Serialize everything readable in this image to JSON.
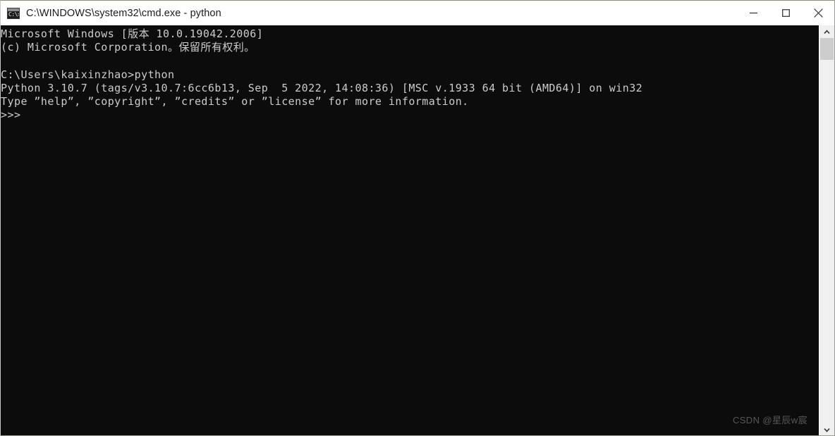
{
  "window": {
    "title": "C:\\WINDOWS\\system32\\cmd.exe - python",
    "icon": "cmd-icon",
    "icon_glyph": "C:\\>",
    "background_color": "#0c0c0c",
    "text_color": "#cccccc",
    "titlebar_color": "#ffffff",
    "controls": {
      "minimize": "minimize-icon",
      "maximize": "maximize-icon",
      "close": "close-icon"
    }
  },
  "console": {
    "lines": [
      "Microsoft Windows [版本 10.0.19042.2006]",
      "(c) Microsoft Corporation。保留所有权利。",
      "",
      "C:\\Users\\kaixinzhao>python",
      "Python 3.10.7 (tags/v3.10.7:6cc6b13, Sep  5 2022, 14:08:36) [MSC v.1933 64 bit (AMD64)] on win32",
      "Type ”help”, ”copyright”, ”credits” or ”license” for more information.",
      ">>>"
    ],
    "text": "Microsoft Windows [版本 10.0.19042.2006]\n(c) Microsoft Corporation。保留所有权利。\n\nC:\\Users\\kaixinzhao>python\nPython 3.10.7 (tags/v3.10.7:6cc6b13, Sep  5 2022, 14:08:36) [MSC v.1933 64 bit (AMD64)] on win32\nType ”help”, ”copyright”, ”credits” or ”license” for more information.\n>>>",
    "prompt": ">>>",
    "current_directory": "C:\\Users\\kaixinzhao",
    "command_entered": "python",
    "python_version": "3.10.7",
    "windows_version": "10.0.19042.2006"
  },
  "scrollbar": {
    "up_arrow": "chevron-up-icon",
    "down_arrow": "chevron-down-icon",
    "thumb": "scroll-thumb"
  },
  "watermark": {
    "text": "CSDN @星辰w宸"
  }
}
